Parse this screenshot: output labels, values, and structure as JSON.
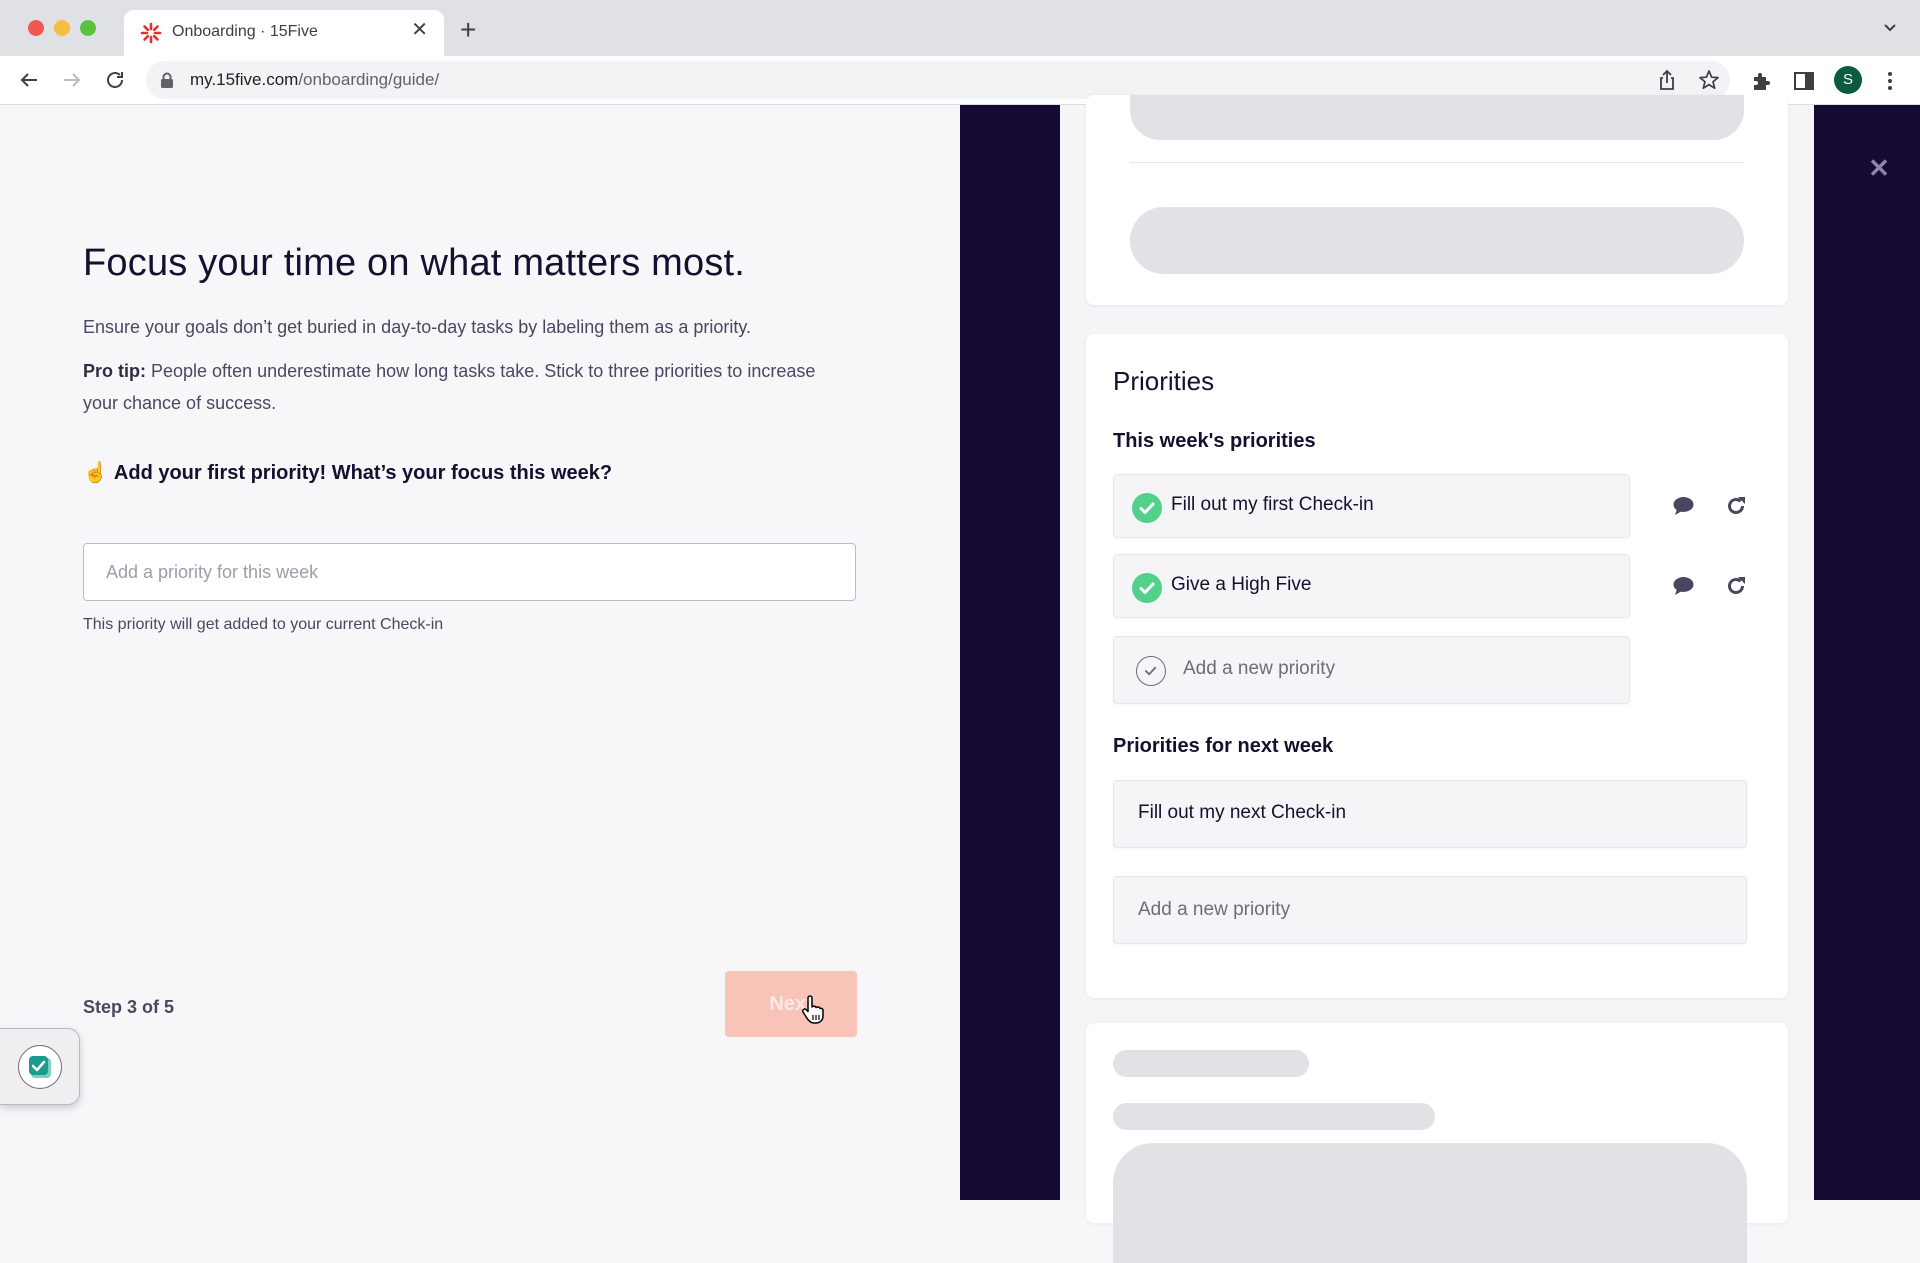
{
  "browser": {
    "tab_title": "Onboarding · 15Five",
    "url_host": "my.15five.com",
    "url_path": "/onboarding/guide/",
    "profile_initial": "S",
    "favicon_color": "#e0322f",
    "profile_color": "#0d5b3e"
  },
  "onboarding": {
    "heading": "Focus your time on what matters most.",
    "intro": "Ensure your goals don’t get buried in day-to-day tasks by labeling them as a priority.",
    "pro_tip_label": "Pro tip:",
    "pro_tip_text": " People often underestimate how long tasks take. Stick to three priorities to increase your chance of success.",
    "prompt_emoji": "☝️",
    "prompt": "Add your first priority! What’s your focus this week?",
    "input_value": "",
    "input_placeholder": "Add a priority for this week",
    "helper_text": "This priority will get added to your current Check-in",
    "step_text": "Step 3 of 5",
    "next_label": "Next",
    "next_color": "#f8c4b8"
  },
  "preview": {
    "close_label": "✕",
    "priorities_title": "Priorities",
    "this_week_label": "This week's priorities",
    "this_week_items": [
      {
        "text": "Fill out my first Check-in",
        "done": true
      },
      {
        "text": "Give a High Five",
        "done": true
      }
    ],
    "this_week_add_placeholder": "Add a new priority",
    "next_week_label": "Priorities for next week",
    "next_week_items": [
      {
        "text": "Fill out my next Check-in"
      }
    ],
    "next_week_add_placeholder": "Add a new priority",
    "check_color": "#52d18a",
    "panel_color": "#150a33"
  }
}
